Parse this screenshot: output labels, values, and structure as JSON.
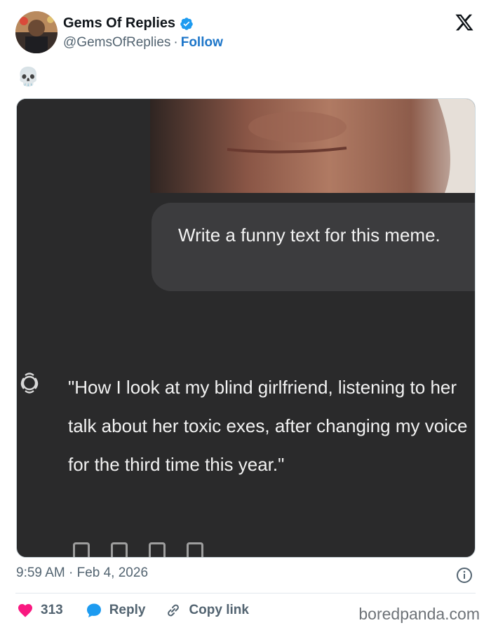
{
  "author": {
    "display_name": "Gems Of Replies",
    "handle": "@GemsOfReplies",
    "separator": "·",
    "follow_label": "Follow"
  },
  "tweet": {
    "text": "💀"
  },
  "media": {
    "prompt_text": "Write a funny text for this meme.",
    "reply_text": "\"How I look at my blind girlfriend, listening to her talk about her toxic exes, after changing my voice for the third time this year.\""
  },
  "meta": {
    "timestamp": "9:59 AM · Feb 4, 2026"
  },
  "actions": {
    "likes": "313",
    "reply_label": "Reply",
    "copy_link_label": "Copy link"
  },
  "watermark": "boredpanda.com",
  "colors": {
    "accent": "#1d9bf0",
    "like": "#f91880",
    "dark_bg": "#2a2a2b",
    "bubble": "#3c3c3e"
  },
  "icons": [
    "verified-badge-icon",
    "x-logo-icon",
    "heart-icon",
    "reply-bubble-icon",
    "link-icon",
    "info-icon",
    "chatgpt-logo-icon"
  ]
}
